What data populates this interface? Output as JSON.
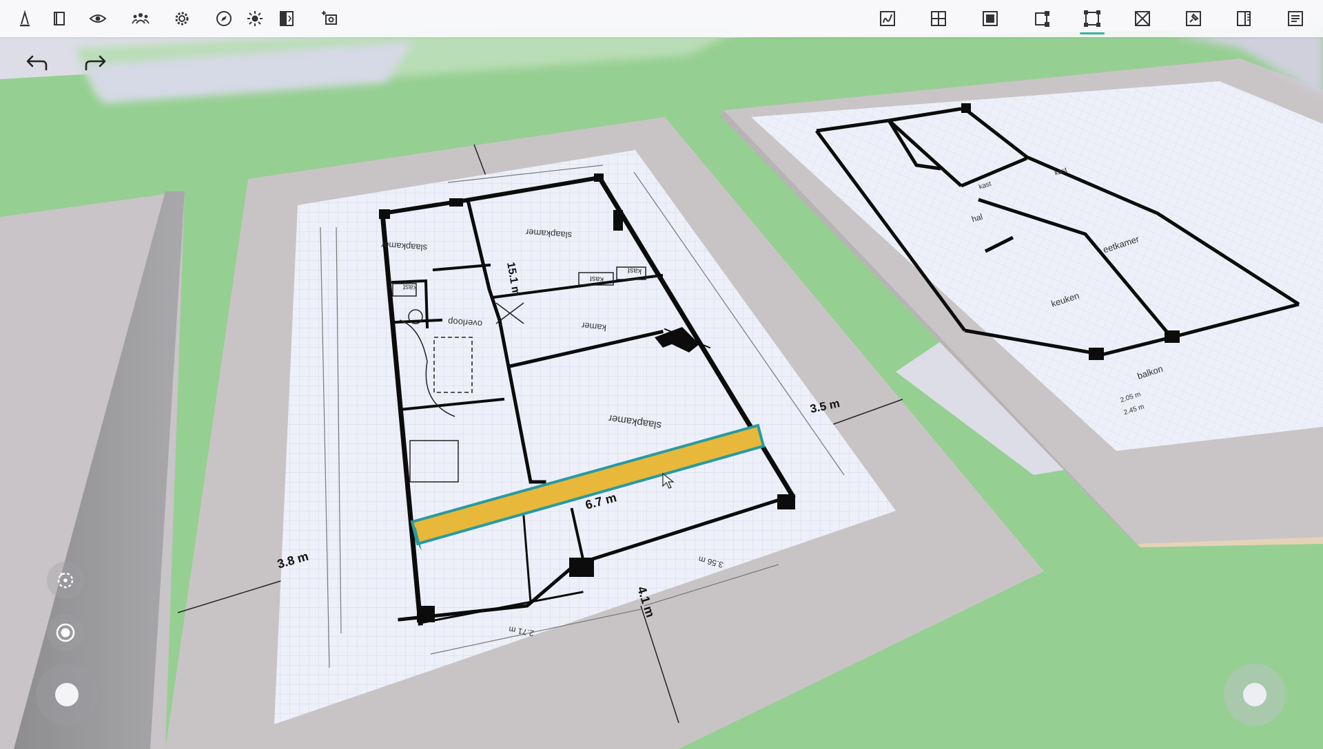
{
  "toolbar": {
    "left_tools": [
      {
        "name": "draw-tool-icon"
      },
      {
        "name": "floors-icon"
      },
      {
        "name": "visibility-icon"
      },
      {
        "name": "people-icon"
      },
      {
        "name": "settings-icon"
      },
      {
        "name": "compass-icon"
      },
      {
        "name": "sun-icon"
      },
      {
        "name": "split-view-icon"
      },
      {
        "name": "camera-icon"
      }
    ],
    "right_tools": [
      {
        "name": "sketch-tool-icon"
      },
      {
        "name": "room-grid-icon"
      },
      {
        "name": "floor-fill-icon"
      },
      {
        "name": "wall-node-icon"
      },
      {
        "name": "surface-select-icon",
        "active": true
      },
      {
        "name": "remove-surface-icon"
      },
      {
        "name": "pin-icon"
      },
      {
        "name": "measure-panel-icon"
      },
      {
        "name": "notes-icon"
      }
    ],
    "accent": "#36b39a"
  },
  "history": {
    "undo": "undo-icon",
    "redo": "redo-icon"
  },
  "view_controls": [
    "orbit-icon",
    "focus-icon",
    "joystick-icon"
  ],
  "measurements": {
    "length_long": "15.1 m",
    "length_wall": "6.7 m",
    "width_left": "3.8 m",
    "width_right": "3.5 m",
    "depth_bottom": "4.1 m"
  },
  "plan_labels": {
    "bedroom_top_left": "slaapkamer",
    "closet_1": "kast",
    "closet_2": "kast",
    "closet_3": "kast",
    "bedroom_top_right": "slaapkamer",
    "landing": "overloop",
    "room": "kamer",
    "bedroom_main": "slaapkamer",
    "dim_1": "2.71 m",
    "dim_2": "3.56 m"
  },
  "plan2_labels": {
    "living": "eetkamer",
    "kitchen": "keuken",
    "hall": "hal",
    "balcony": "balkon",
    "dim_a": "2.05 m",
    "dim_b": "2.45 m",
    "kast_a": "kast",
    "kast_b": "kast"
  },
  "colors": {
    "grass": "#96cf92",
    "ground": "#dcdde6",
    "slab": "#c9c4c6",
    "paper": "#eef0f9",
    "selected_wall": "#e8b83a",
    "selected_outline": "#2a9aa0"
  }
}
